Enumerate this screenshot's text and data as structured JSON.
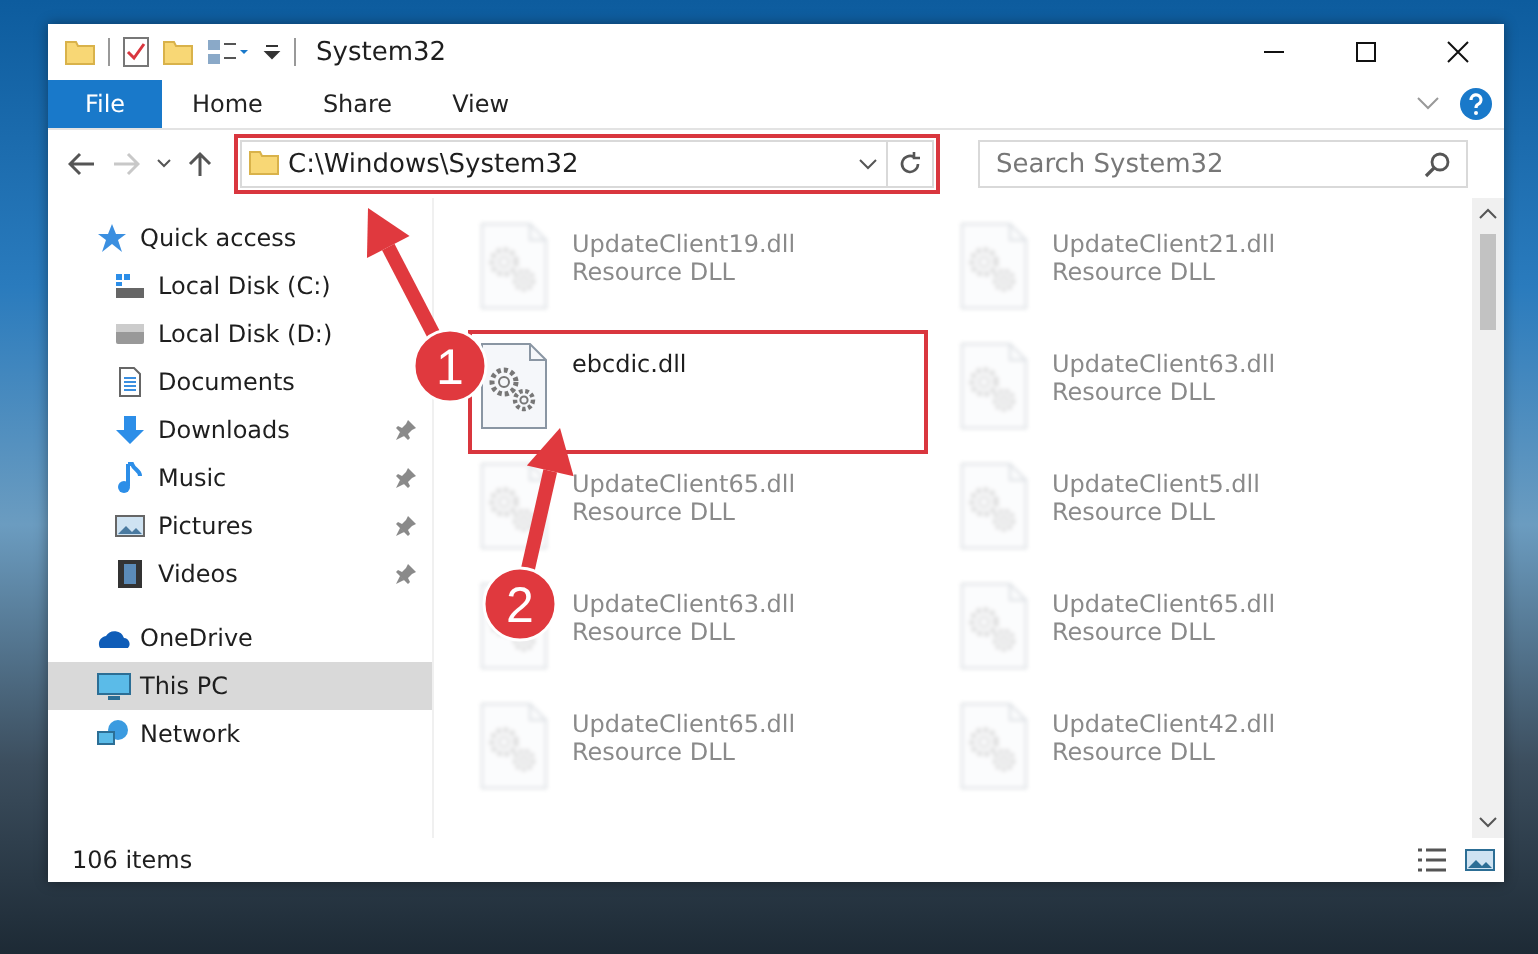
{
  "window": {
    "title": "System32"
  },
  "ribbon_tabs": [
    {
      "label": "File",
      "kind": "file"
    },
    {
      "label": "Home",
      "kind": "tab"
    },
    {
      "label": "Share",
      "kind": "tab"
    },
    {
      "label": "View",
      "kind": "tab"
    }
  ],
  "address_bar": {
    "path": "C:\\Windows\\System32",
    "highlighted": true
  },
  "search": {
    "placeholder": "Search System32"
  },
  "sidebar": {
    "items": [
      {
        "label": "Quick access",
        "kind": "star",
        "selected": false,
        "children": [
          {
            "label": "Local Disk (C:)",
            "kind": "drive-win",
            "pinned": false
          },
          {
            "label": "Local Disk (D:)",
            "kind": "drive",
            "pinned": false
          },
          {
            "label": "Documents",
            "kind": "document",
            "pinned": false
          },
          {
            "label": "Downloads",
            "kind": "download",
            "pinned": true
          },
          {
            "label": "Music",
            "kind": "music",
            "pinned": true
          },
          {
            "label": "Pictures",
            "kind": "picture",
            "pinned": true
          },
          {
            "label": "Videos",
            "kind": "video",
            "pinned": true
          }
        ]
      },
      {
        "label": "OneDrive",
        "kind": "cloud",
        "selected": false
      },
      {
        "label": "This PC",
        "kind": "pc",
        "selected": true
      },
      {
        "label": "Network",
        "kind": "network",
        "selected": false
      }
    ]
  },
  "files": [
    {
      "name": "UpdateClient19.dll",
      "type": "Resource DLL",
      "blurred": true,
      "highlighted": false
    },
    {
      "name": "UpdateClient21.dll",
      "type": "Resource DLL",
      "blurred": true,
      "highlighted": false
    },
    {
      "name": "ebcdic.dll",
      "blurred": false,
      "highlighted": true
    },
    {
      "name": "UpdateClient63.dll",
      "type": "Resource DLL",
      "blurred": true,
      "highlighted": false
    },
    {
      "name": "UpdateClient65.dll",
      "type": "Resource DLL",
      "blurred": true,
      "highlighted": false
    },
    {
      "name": "UpdateClient5.dll",
      "type": "Resource DLL",
      "blurred": true,
      "highlighted": false
    },
    {
      "name": "UpdateClient63.dll",
      "type": "Resource DLL",
      "blurred": true,
      "highlighted": false
    },
    {
      "name": "UpdateClient65.dll",
      "type": "Resource DLL",
      "blurred": true,
      "highlighted": false
    },
    {
      "name": "UpdateClient65.dll",
      "type": "Resource DLL",
      "blurred": true,
      "highlighted": false
    },
    {
      "name": "UpdateClient42.dll",
      "type": "Resource DLL",
      "blurred": true,
      "highlighted": false
    }
  ],
  "status_bar": {
    "item_count": "106 items"
  },
  "annotations": [
    {
      "label": "1"
    },
    {
      "label": "2"
    }
  ]
}
